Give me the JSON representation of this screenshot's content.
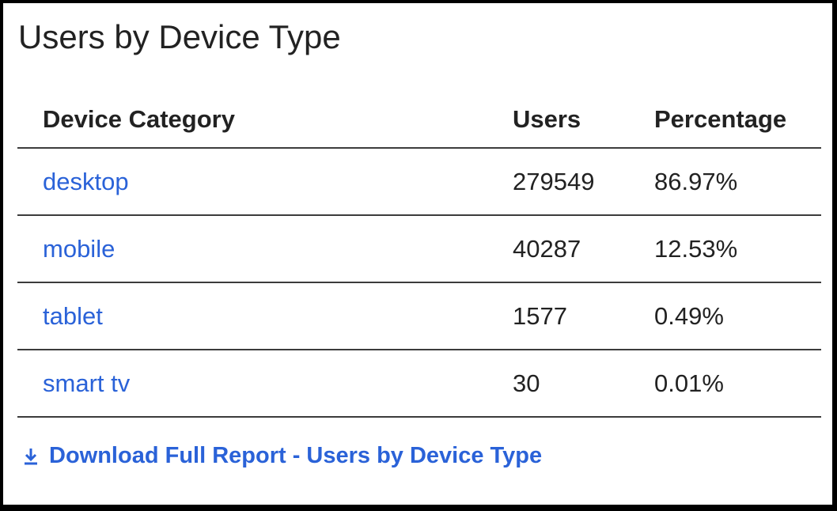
{
  "widget": {
    "title": "Users by Device Type"
  },
  "table": {
    "columns": [
      "Device Category",
      "Users",
      "Percentage"
    ],
    "rows": [
      {
        "device": "desktop",
        "users": "279549",
        "percentage": "86.97%"
      },
      {
        "device": "mobile",
        "users": "40287",
        "percentage": "12.53%"
      },
      {
        "device": "tablet",
        "users": "1577",
        "percentage": "0.49%"
      },
      {
        "device": "smart tv",
        "users": "30",
        "percentage": "0.01%"
      }
    ]
  },
  "download": {
    "label": "Download Full Report - Users by Device Type",
    "icon": "download-icon"
  },
  "colors": {
    "link": "#2a62d8",
    "text": "#222222",
    "border": "#000000"
  }
}
